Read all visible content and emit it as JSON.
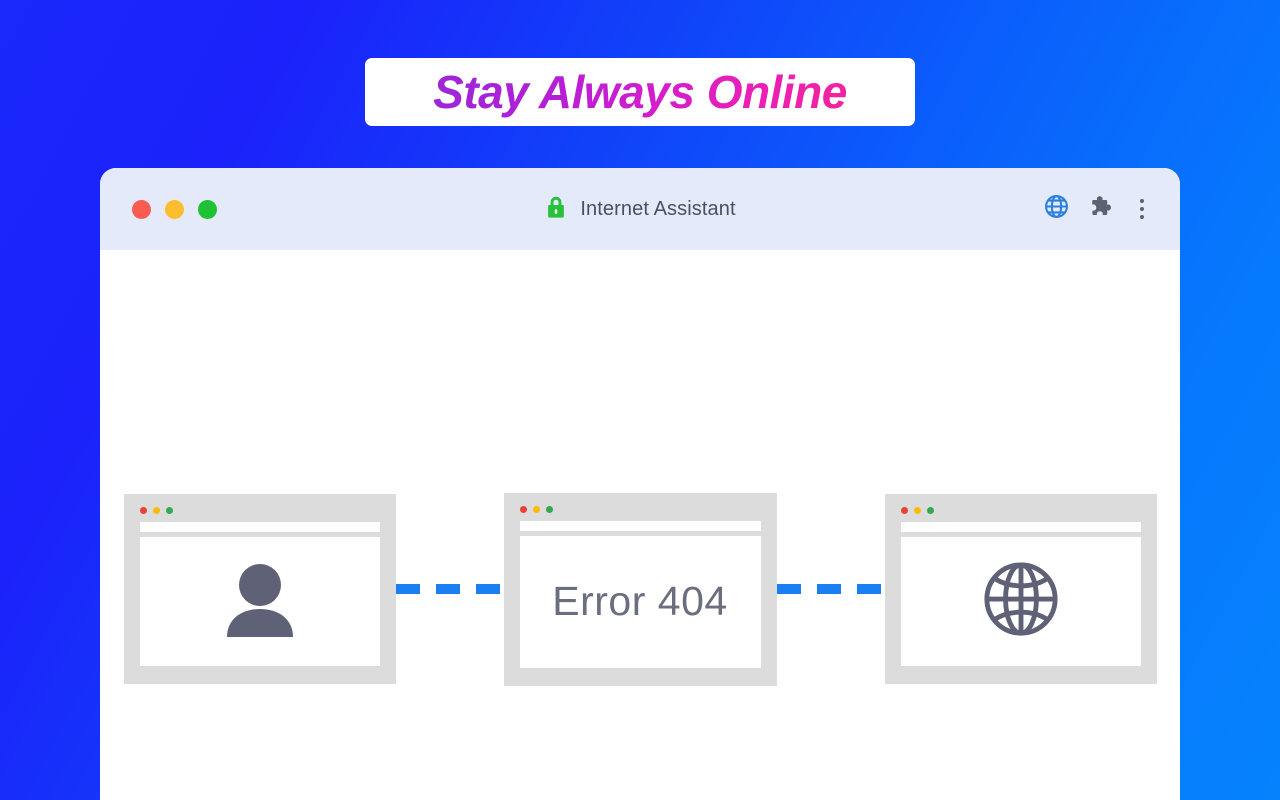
{
  "banner": {
    "text": "Stay Always Online",
    "gradient_start": "#9b27d8",
    "gradient_end": "#f4229c",
    "background": "#ffffff"
  },
  "background": {
    "gradient_start": "#1a28fb",
    "gradient_end": "#0682fd"
  },
  "browser": {
    "title": "Internet Assistant",
    "lock_icon": "green-padlock-icon",
    "traffic_lights": [
      {
        "name": "close",
        "color": "#fa5c52"
      },
      {
        "name": "minimize",
        "color": "#fcbd2e"
      },
      {
        "name": "maximize",
        "color": "#1fc234"
      }
    ],
    "toolbar_icons": [
      {
        "name": "globe-icon",
        "color": "#2a7fe0"
      },
      {
        "name": "puzzle-piece-icon",
        "color": "#5c6274"
      },
      {
        "name": "kebab-menu-icon",
        "color": "#5c6274"
      }
    ]
  },
  "cards": [
    {
      "id": "user-card",
      "content_type": "icon",
      "icon": "user-avatar-icon",
      "text": "",
      "frame_color": "#dcdcdc",
      "icon_color": "#5f6276"
    },
    {
      "id": "error-card",
      "content_type": "text",
      "icon": "",
      "text": "Error 404",
      "frame_color": "#dcdcdc",
      "text_color": "#6a6e80"
    },
    {
      "id": "internet-card",
      "content_type": "icon",
      "icon": "globe-wireframe-icon",
      "text": "",
      "frame_color": "#dcdcdc",
      "icon_color": "#5f6276"
    }
  ],
  "connectors": [
    {
      "id": "connector-1",
      "style": "dashed",
      "color": "#1a7ff0"
    },
    {
      "id": "connector-2",
      "style": "dashed",
      "color": "#1a7ff0"
    }
  ]
}
